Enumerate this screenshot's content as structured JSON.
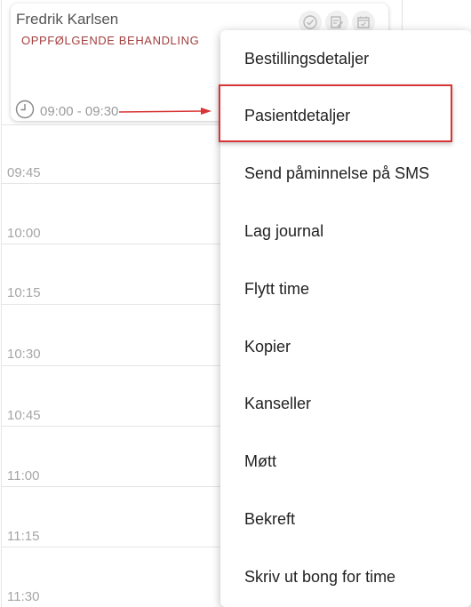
{
  "appointment": {
    "patient_name": "Fredrik Karlsen",
    "type": "OPPFØLGENDE BEHANDLING",
    "time_range": "09:00 - 09:30"
  },
  "time_slots": [
    "09:45",
    "10:00",
    "10:15",
    "10:30",
    "10:45",
    "11:00",
    "11:15",
    "11:30"
  ],
  "context_menu": {
    "items": [
      "Bestillingsdetaljer",
      "Pasientdetaljer",
      "Send påminnelse på SMS",
      "Lag journal",
      "Flytt time",
      "Kopier",
      "Kanseller",
      "Møtt",
      "Bekreft",
      "Skriv ut bong for time"
    ],
    "highlighted_item": "Pasientdetaljer"
  },
  "colors": {
    "appointment_type": "#a23f3f",
    "highlight_border": "#d83535",
    "annotation_arrow": "#d83535",
    "slot_label": "#a5a5a5"
  },
  "icons": [
    "clock-icon",
    "check-circle-icon",
    "edit-note-icon",
    "calendar-check-icon"
  ]
}
